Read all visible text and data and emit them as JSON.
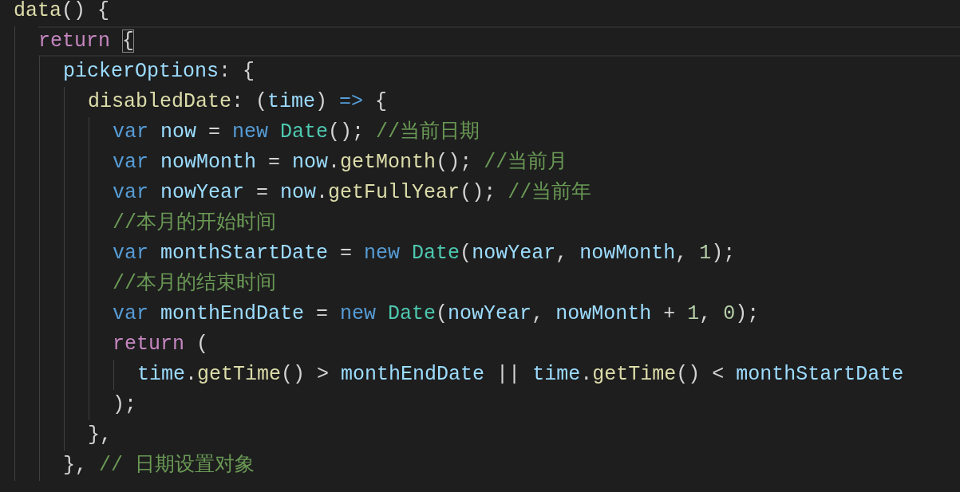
{
  "editor": {
    "lines": [
      {
        "tokens": [
          {
            "kind": "function",
            "text": "data"
          },
          {
            "kind": "punct",
            "text": "() {"
          }
        ],
        "children": [
          {
            "current": true,
            "tokens": [
              {
                "kind": "control",
                "text": "return "
              },
              {
                "kind": "punct",
                "text": "{",
                "matched": true
              }
            ],
            "children": [
              {
                "tokens": [
                  {
                    "kind": "variable",
                    "text": "pickerOptions"
                  },
                  {
                    "kind": "punct",
                    "text": ": {"
                  }
                ],
                "children": [
                  {
                    "tokens": [
                      {
                        "kind": "function",
                        "text": "disabledDate"
                      },
                      {
                        "kind": "punct",
                        "text": ": ("
                      },
                      {
                        "kind": "variable",
                        "text": "time"
                      },
                      {
                        "kind": "punct",
                        "text": ") "
                      },
                      {
                        "kind": "keyword",
                        "text": "=>"
                      },
                      {
                        "kind": "punct",
                        "text": " {"
                      }
                    ],
                    "children": [
                      {
                        "tokens": [
                          {
                            "kind": "keyword",
                            "text": "var "
                          },
                          {
                            "kind": "variable",
                            "text": "now"
                          },
                          {
                            "kind": "punct",
                            "text": " = "
                          },
                          {
                            "kind": "keyword",
                            "text": "new "
                          },
                          {
                            "kind": "class",
                            "text": "Date"
                          },
                          {
                            "kind": "punct",
                            "text": "(); "
                          },
                          {
                            "kind": "comment",
                            "text": "//当前日期"
                          }
                        ]
                      },
                      {
                        "tokens": [
                          {
                            "kind": "keyword",
                            "text": "var "
                          },
                          {
                            "kind": "variable",
                            "text": "nowMonth"
                          },
                          {
                            "kind": "punct",
                            "text": " = "
                          },
                          {
                            "kind": "variable",
                            "text": "now"
                          },
                          {
                            "kind": "punct",
                            "text": "."
                          },
                          {
                            "kind": "function",
                            "text": "getMonth"
                          },
                          {
                            "kind": "punct",
                            "text": "(); "
                          },
                          {
                            "kind": "comment",
                            "text": "//当前月"
                          }
                        ]
                      },
                      {
                        "tokens": [
                          {
                            "kind": "keyword",
                            "text": "var "
                          },
                          {
                            "kind": "variable",
                            "text": "nowYear"
                          },
                          {
                            "kind": "punct",
                            "text": " = "
                          },
                          {
                            "kind": "variable",
                            "text": "now"
                          },
                          {
                            "kind": "punct",
                            "text": "."
                          },
                          {
                            "kind": "function",
                            "text": "getFullYear"
                          },
                          {
                            "kind": "punct",
                            "text": "(); "
                          },
                          {
                            "kind": "comment",
                            "text": "//当前年"
                          }
                        ]
                      },
                      {
                        "tokens": [
                          {
                            "kind": "comment",
                            "text": "//本月的开始时间"
                          }
                        ]
                      },
                      {
                        "tokens": [
                          {
                            "kind": "keyword",
                            "text": "var "
                          },
                          {
                            "kind": "variable",
                            "text": "monthStartDate"
                          },
                          {
                            "kind": "punct",
                            "text": " = "
                          },
                          {
                            "kind": "keyword",
                            "text": "new "
                          },
                          {
                            "kind": "class",
                            "text": "Date"
                          },
                          {
                            "kind": "punct",
                            "text": "("
                          },
                          {
                            "kind": "variable",
                            "text": "nowYear"
                          },
                          {
                            "kind": "punct",
                            "text": ", "
                          },
                          {
                            "kind": "variable",
                            "text": "nowMonth"
                          },
                          {
                            "kind": "punct",
                            "text": ", "
                          },
                          {
                            "kind": "number",
                            "text": "1"
                          },
                          {
                            "kind": "punct",
                            "text": ");"
                          }
                        ]
                      },
                      {
                        "tokens": [
                          {
                            "kind": "comment",
                            "text": "//本月的结束时间"
                          }
                        ]
                      },
                      {
                        "tokens": [
                          {
                            "kind": "keyword",
                            "text": "var "
                          },
                          {
                            "kind": "variable",
                            "text": "monthEndDate"
                          },
                          {
                            "kind": "punct",
                            "text": " = "
                          },
                          {
                            "kind": "keyword",
                            "text": "new "
                          },
                          {
                            "kind": "class",
                            "text": "Date"
                          },
                          {
                            "kind": "punct",
                            "text": "("
                          },
                          {
                            "kind": "variable",
                            "text": "nowYear"
                          },
                          {
                            "kind": "punct",
                            "text": ", "
                          },
                          {
                            "kind": "variable",
                            "text": "nowMonth"
                          },
                          {
                            "kind": "punct",
                            "text": " + "
                          },
                          {
                            "kind": "number",
                            "text": "1"
                          },
                          {
                            "kind": "punct",
                            "text": ", "
                          },
                          {
                            "kind": "number",
                            "text": "0"
                          },
                          {
                            "kind": "punct",
                            "text": ");"
                          }
                        ]
                      },
                      {
                        "tokens": [
                          {
                            "kind": "control",
                            "text": "return"
                          },
                          {
                            "kind": "punct",
                            "text": " ("
                          }
                        ],
                        "children": [
                          {
                            "tokens": [
                              {
                                "kind": "variable",
                                "text": "time"
                              },
                              {
                                "kind": "punct",
                                "text": "."
                              },
                              {
                                "kind": "function",
                                "text": "getTime"
                              },
                              {
                                "kind": "punct",
                                "text": "() > "
                              },
                              {
                                "kind": "variable",
                                "text": "monthEndDate"
                              },
                              {
                                "kind": "punct",
                                "text": " || "
                              },
                              {
                                "kind": "variable",
                                "text": "time"
                              },
                              {
                                "kind": "punct",
                                "text": "."
                              },
                              {
                                "kind": "function",
                                "text": "getTime"
                              },
                              {
                                "kind": "punct",
                                "text": "() < "
                              },
                              {
                                "kind": "variable",
                                "text": "monthStartDate"
                              }
                            ]
                          }
                        ]
                      },
                      {
                        "tokens": [
                          {
                            "kind": "punct",
                            "text": ");"
                          }
                        ]
                      }
                    ]
                  },
                  {
                    "tokens": [
                      {
                        "kind": "punct",
                        "text": "},"
                      }
                    ]
                  }
                ]
              },
              {
                "tokens": [
                  {
                    "kind": "punct",
                    "text": "}, "
                  },
                  {
                    "kind": "comment",
                    "text": "// 日期设置对象"
                  }
                ]
              }
            ]
          }
        ]
      }
    ]
  }
}
